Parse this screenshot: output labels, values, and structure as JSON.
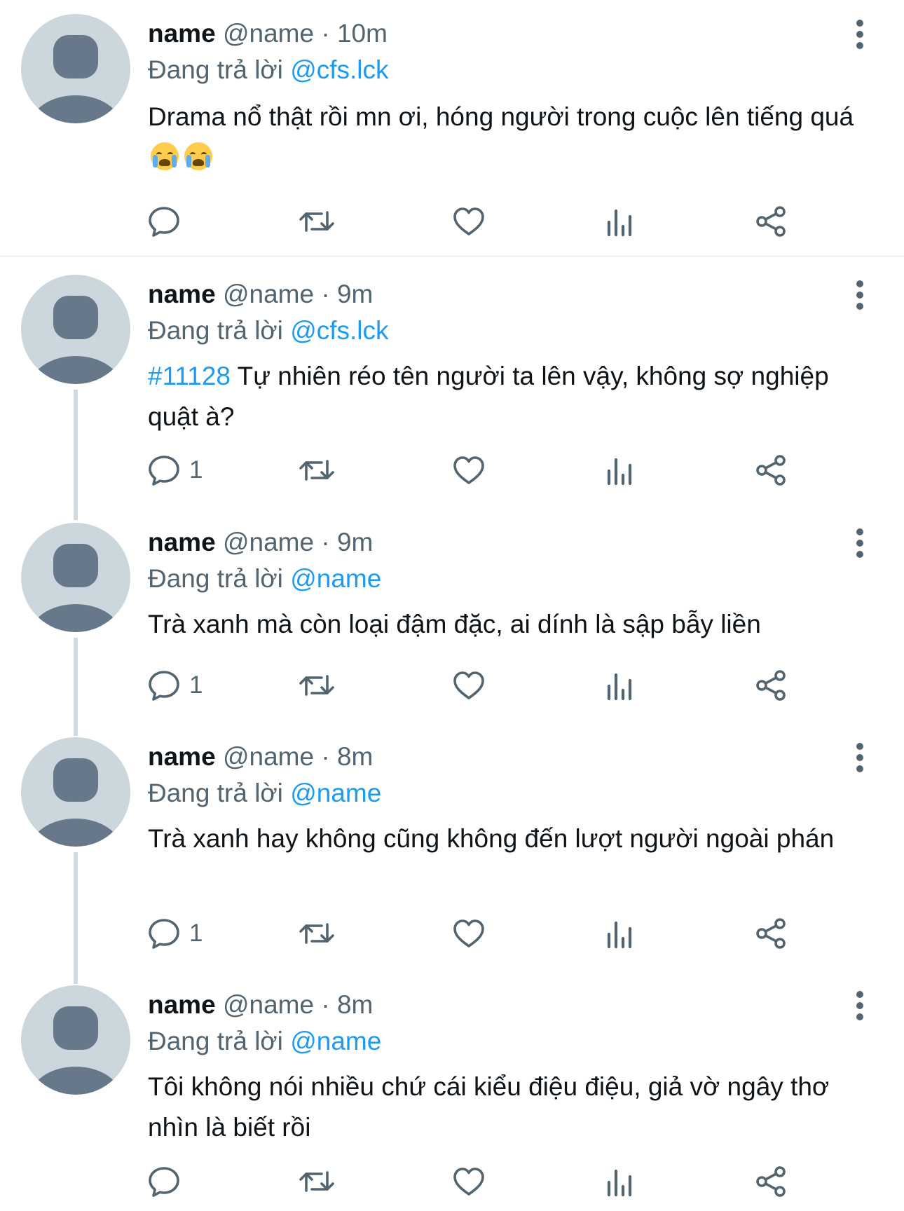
{
  "colors": {
    "text": "#0f1419",
    "muted": "#536471",
    "accent": "#1d9bf0",
    "avatar_bg": "#ccd6dd",
    "avatar_fg": "#66788a",
    "thread_line": "#cfd9de"
  },
  "reply_prefix": "Đang trả lời",
  "posts": [
    {
      "name": "name",
      "handle": "@name",
      "sep": "·",
      "time": "10m",
      "reply_to": "@cfs.lck",
      "hashtag": "",
      "text": "Drama nổ thật rồi mn ơi, hóng người trong cuộc lên tiếng quá",
      "emojis": "😭 😭",
      "reply_count": ""
    },
    {
      "name": "name",
      "handle": "@name",
      "sep": "·",
      "time": "9m",
      "reply_to": "@cfs.lck",
      "hashtag": "#11128",
      "text": "Tự nhiên réo tên người ta lên vậy, không sợ nghiệp quật à?",
      "emojis": "",
      "reply_count": "1"
    },
    {
      "name": "name",
      "handle": "@name",
      "sep": "·",
      "time": "9m",
      "reply_to": "@name",
      "hashtag": "",
      "text": "Trà xanh mà còn loại đậm đặc, ai dính là sập bẫy liền",
      "emojis": "",
      "reply_count": "1"
    },
    {
      "name": "name",
      "handle": "@name",
      "sep": "·",
      "time": "8m",
      "reply_to": "@name",
      "hashtag": "",
      "text": "Trà xanh hay không cũng không đến lượt người ngoài phán",
      "emojis": "",
      "reply_count": "1"
    },
    {
      "name": "name",
      "handle": "@name",
      "sep": "·",
      "time": "8m",
      "reply_to": "@name",
      "hashtag": "",
      "text": "Tôi không nói nhiều chứ cái kiểu điệu điệu, giả vờ ngây thơ nhìn là biết rồi",
      "emojis": "",
      "reply_count": ""
    }
  ],
  "icons": {
    "more": "more-vertical-icon",
    "reply": "reply-bubble-icon",
    "repost": "repost-icon",
    "like": "heart-icon",
    "views": "bar-chart-icon",
    "share": "share-icon",
    "avatar": "default-avatar-icon"
  }
}
